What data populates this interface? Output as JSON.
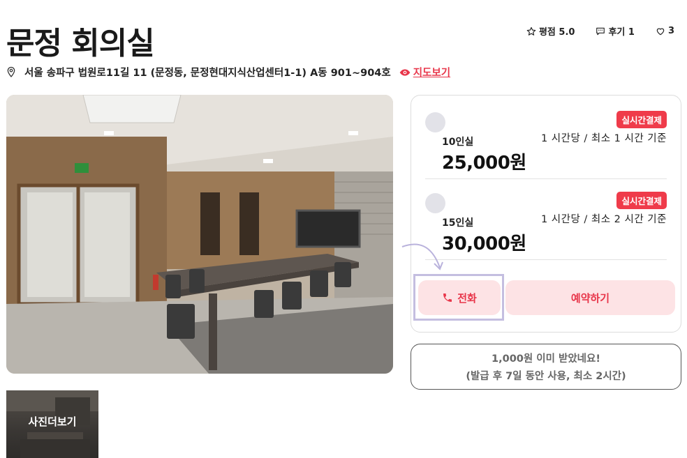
{
  "space": {
    "title": "문정 회의실",
    "address": "서울 송파구 법원로11길 11 (문정동, 문정현대지식산업센터1-1) A동 901~904호",
    "map_link": "지도보기"
  },
  "header_actions": {
    "rating": "평점 5.0",
    "reviews": "후기 1",
    "likes": "3"
  },
  "gallery": {
    "more_photos": "사진더보기"
  },
  "rooms": [
    {
      "badge": "실시간결제",
      "name": "10인실",
      "price": "25,000원",
      "rate": "1 시간당 / 최소 1 시간 기준"
    },
    {
      "badge": "실시간결제",
      "name": "15인실",
      "price": "30,000원",
      "rate": "1 시간당 / 최소 2 시간 기준"
    }
  ],
  "buttons": {
    "call": "전화",
    "reserve": "예약하기"
  },
  "coupon": {
    "line1": "1,000원 이미 받았네요!",
    "line2": "(발급 후 7일 동안 사용, 최소 2시간)"
  },
  "colors": {
    "accent": "#e8364a",
    "accent_soft": "#fde3e5",
    "badge": "#ef3b4a",
    "highlight": "#c4bee0"
  }
}
